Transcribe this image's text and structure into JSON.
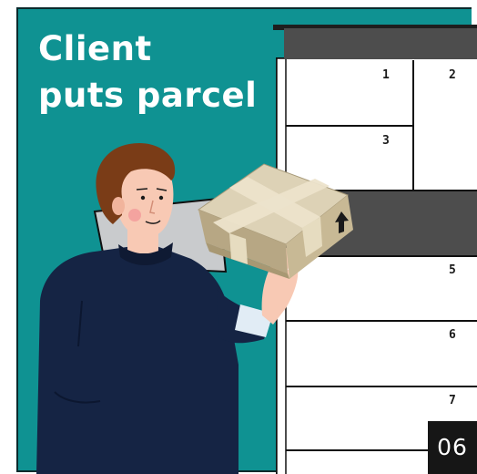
{
  "headline": {
    "line1": "Client",
    "line2": "puts parcel"
  },
  "locker": {
    "compartments": [
      {
        "number": "1"
      },
      {
        "number": "2"
      },
      {
        "number": "3"
      },
      {
        "number": "5"
      },
      {
        "number": "6"
      },
      {
        "number": "7"
      }
    ]
  },
  "slide_number": "06",
  "colors": {
    "background": "#0f9292",
    "headline_text": "#ffffff",
    "person_sweater": "#152444",
    "person_hair": "#7a3c17",
    "person_skin": "#f8c9b4",
    "parcel_cardboard": "#cfc2a1",
    "parcel_tape": "#ece3cb",
    "locker_header": "#4d4d4d",
    "locker_body": "#ffffff",
    "slide_badge": "#161616"
  },
  "icons": {
    "parcel_arrow": "up-arrow-icon"
  }
}
